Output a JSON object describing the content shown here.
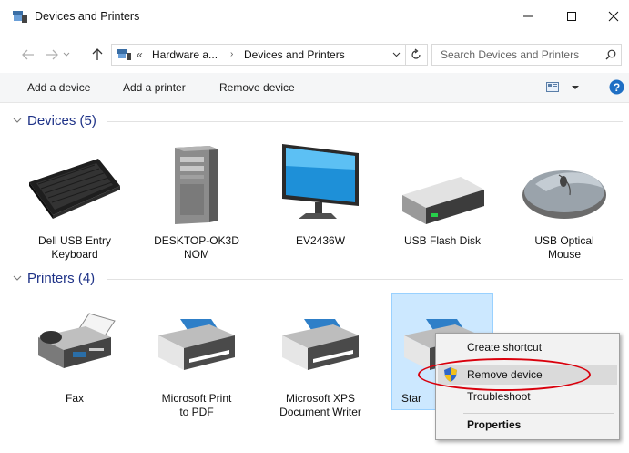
{
  "window": {
    "title": "Devices and Printers"
  },
  "address": {
    "overflow": "«",
    "crumb1": "Hardware a...",
    "crumb2": "Devices and Printers"
  },
  "search": {
    "placeholder": "Search Devices and Printers"
  },
  "toolbar": {
    "add_device": "Add a device",
    "add_printer": "Add a printer",
    "remove_device": "Remove device"
  },
  "groups": {
    "devices": "Devices (5)",
    "printers": "Printers (4)"
  },
  "devices": [
    {
      "line1": "Dell USB Entry",
      "line2": "Keyboard"
    },
    {
      "line1": "DESKTOP-OK3D",
      "line2": "NOM"
    },
    {
      "line1": "EV2436W",
      "line2": ""
    },
    {
      "line1": "USB Flash Disk",
      "line2": ""
    },
    {
      "line1": "USB Optical",
      "line2": "Mouse"
    }
  ],
  "printers": [
    {
      "line1": "Fax",
      "line2": ""
    },
    {
      "line1": "Microsoft Print",
      "line2": "to PDF"
    },
    {
      "line1": "Microsoft XPS",
      "line2": "Document Writer"
    },
    {
      "line1": "Star",
      "line2": ""
    }
  ],
  "context_menu": {
    "create_shortcut": "Create shortcut",
    "remove_device": "Remove device",
    "troubleshoot": "Troubleshoot",
    "properties": "Properties"
  },
  "colors": {
    "accent": "#1e3287",
    "selection": "#cce8ff",
    "annotation": "#d9000c"
  }
}
